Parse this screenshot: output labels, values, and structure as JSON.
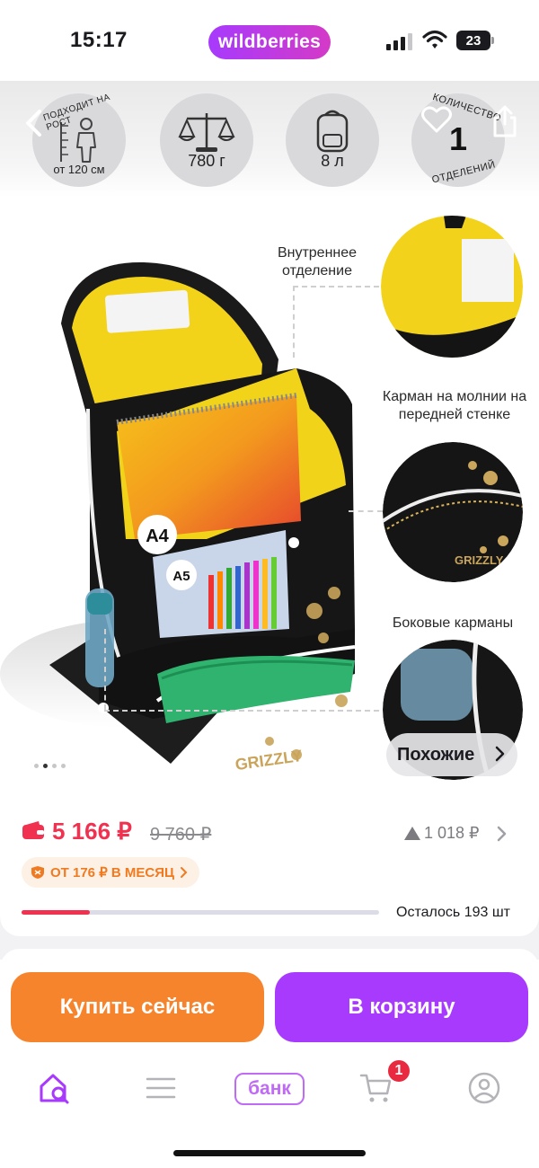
{
  "status_bar": {
    "time": "15:17",
    "battery": "23"
  },
  "brand": {
    "name": "wildberries"
  },
  "features": {
    "height_label": "ПОДХОДИТ НА РОСТ",
    "height_value": "от 120 см",
    "weight_value": "780 г",
    "volume_value": "8 л",
    "compartments_label_top": "КОЛИЧЕСТВО",
    "compartments_value": "1",
    "compartments_label_bottom": "ОТДЕЛЕНИЙ"
  },
  "callouts": {
    "inner": "Внутреннее отделение",
    "zipper": "Карман на молнии на передней стенке",
    "side": "Боковые карманы"
  },
  "image_labels": {
    "a4": "A4",
    "a5": "A5",
    "brand_mark": "GRIZZLY"
  },
  "gallery": {
    "similar_label": "Похожие",
    "current_slide": 2,
    "slide_count": 4
  },
  "price": {
    "current": "5 166 ₽",
    "old": "9 760 ₽",
    "drop": "1 018 ₽",
    "installment": "ОТ 176 ₽ В МЕСЯЦ",
    "stock_text": "Осталось 193 шт",
    "stock_progress": 0.19
  },
  "actions": {
    "buy_now": "Купить сейчас",
    "add_to_cart": "В корзину"
  },
  "tabbar": {
    "bank_label": "банк",
    "cart_count": "1"
  },
  "colors": {
    "accent": "#a73afd",
    "price": "#f0314f",
    "buy": "#f5842c",
    "installment": "#f07a20"
  }
}
